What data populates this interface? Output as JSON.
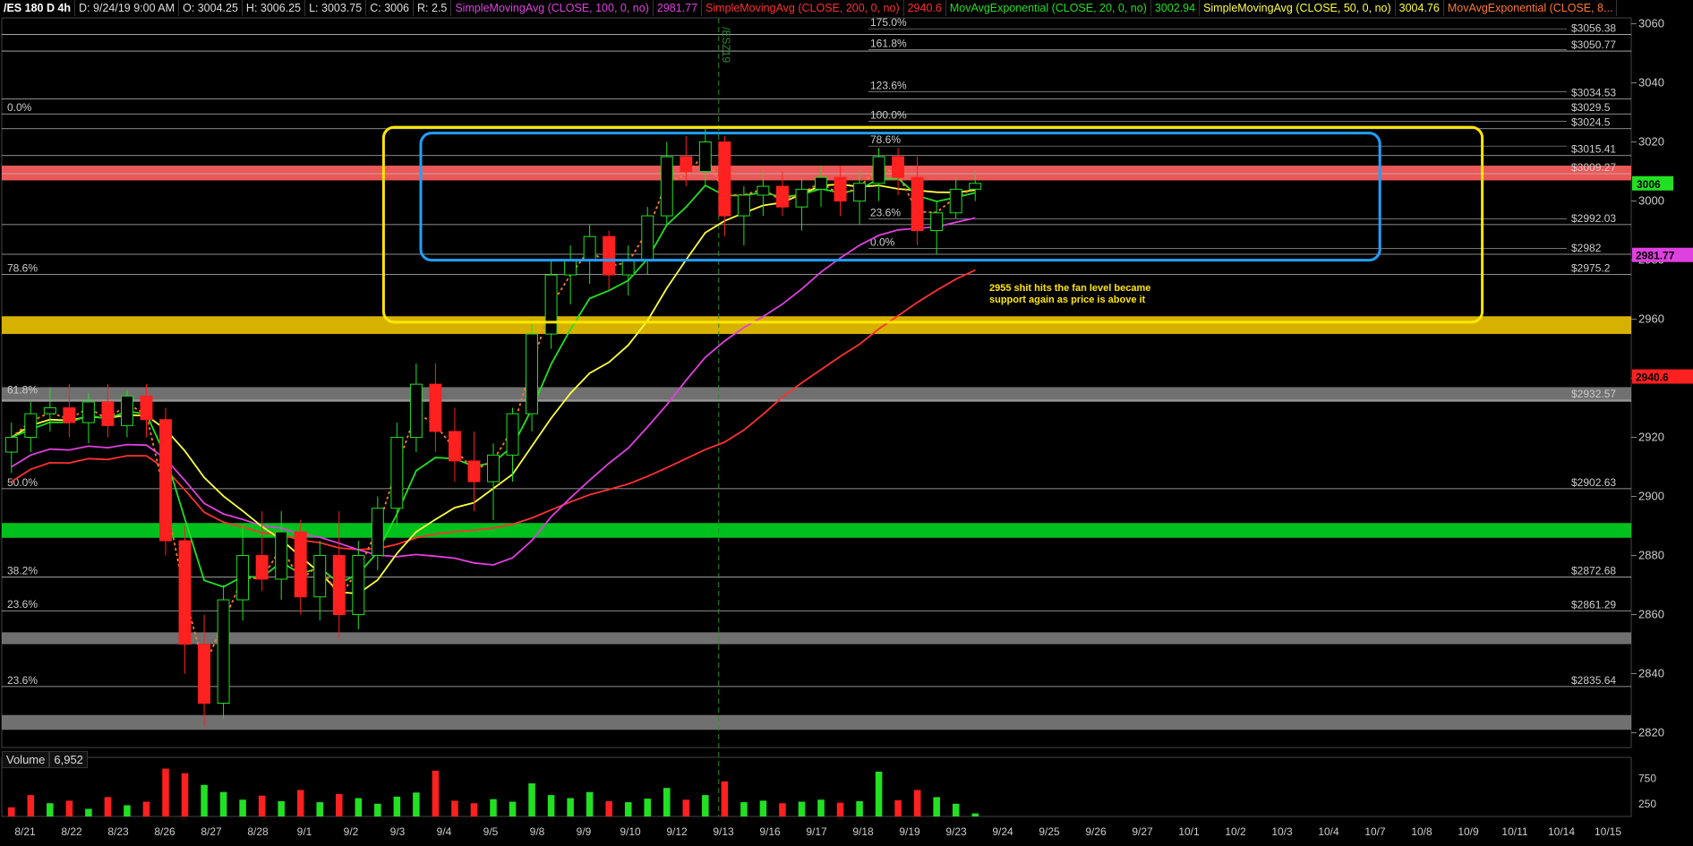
{
  "header": {
    "symbol": "/ES 180 D 4h",
    "date": "D: 9/24/19 9:00 AM",
    "open": "O: 3004.25",
    "high": "H: 3006.25",
    "low": "L: 3003.75",
    "close": "C: 3006",
    "range": "R: 2.5",
    "studies": [
      {
        "label": "SimpleMovingAvg (CLOSE, 100, 0, no)",
        "value": "2981.77",
        "color": "#e040e0"
      },
      {
        "label": "SimpleMovingAvg (CLOSE, 200, 0, no)",
        "value": "2940.6",
        "color": "#ff3030"
      },
      {
        "label": "MovAvgExponential (CLOSE, 20, 0, no)",
        "value": "3002.94",
        "color": "#22e022"
      },
      {
        "label": "SimpleMovingAvg (CLOSE, 50, 0, no)",
        "value": "3004.76",
        "color": "#ffff30"
      },
      {
        "label": "MovAvgExponential (CLOSE, 8...",
        "value": "",
        "color": "#ff7a30"
      }
    ]
  },
  "colors": {
    "up": "#22e022",
    "down": "#ff2020",
    "sma100": "#e040e0",
    "sma200": "#ff3030",
    "ema20": "#22e022",
    "sma50": "#ffff40",
    "ema8": "#ff7a30",
    "red_zone": "#ff6060",
    "yellow_zone": "#e8c000",
    "green_zone": "#00d020",
    "grey_zone": "#7a7a7a",
    "blue_box": "#20a0ff",
    "yellow_box": "#ffe600"
  },
  "chart_data": {
    "type": "candlestick",
    "ylim": [
      2815,
      3062
    ],
    "y_ticks": [
      2820,
      2840,
      2860,
      2880,
      2900,
      2920,
      2940,
      2960,
      2980,
      3000,
      3020,
      3040,
      3060
    ],
    "x_ticks": [
      "8/21",
      "8/22",
      "8/23",
      "8/26",
      "8/27",
      "8/28",
      "9/1",
      "9/2",
      "9/3",
      "9/4",
      "9/5",
      "9/8",
      "9/9",
      "9/10",
      "9/12",
      "9/13",
      "9/16",
      "9/17",
      "9/18",
      "9/19",
      "9/23",
      "9/24",
      "9/25",
      "9/26",
      "9/27",
      "10/1",
      "10/2",
      "10/3",
      "10/4",
      "10/7",
      "10/8",
      "10/9",
      "10/11",
      "10/14",
      "10/15"
    ],
    "last_price": "3006",
    "last_price_value": 3006,
    "badges": [
      {
        "text": "2981.77",
        "value": 2981.77,
        "color": "#e040e0"
      },
      {
        "text": "2940.6",
        "value": 2940.6,
        "color": "#ff2020"
      }
    ],
    "price_levels": [
      {
        "label": "$3056.38",
        "value": 3056.38
      },
      {
        "label": "$3050.77",
        "value": 3050.77
      },
      {
        "label": "$3034.53",
        "value": 3034.53
      },
      {
        "label": "$3029.5",
        "value": 3029.5
      },
      {
        "label": "$3024.5",
        "value": 3024.5
      },
      {
        "label": "$3015.41",
        "value": 3015.41
      },
      {
        "label": "$3009.27",
        "value": 3009.27
      },
      {
        "label": "$2992.03",
        "value": 2992.03
      },
      {
        "label": "$2982",
        "value": 2982
      },
      {
        "label": "$2975.2",
        "value": 2975.2
      },
      {
        "label": "$2932.57",
        "value": 2932.57
      },
      {
        "label": "$2902.63",
        "value": 2902.63
      },
      {
        "label": "$2872.68",
        "value": 2872.68
      },
      {
        "label": "$2861.29",
        "value": 2861.29
      },
      {
        "label": "$2835.64",
        "value": 2835.64
      }
    ],
    "fib_right": [
      {
        "label": "175.0%",
        "value": 3058.3
      },
      {
        "label": "161.8%",
        "value": 3051.2
      },
      {
        "label": "123.6%",
        "value": 3037.0
      },
      {
        "label": "100.0%",
        "value": 3027.0
      },
      {
        "label": "78.6%",
        "value": 3018.6
      },
      {
        "label": "23.6%",
        "value": 2994.0
      },
      {
        "label": "0.0%",
        "value": 2984.0
      }
    ],
    "fib_left": [
      {
        "label": "0.0%",
        "value": 3029.5
      },
      {
        "label": "78.6%",
        "value": 2975.2
      },
      {
        "label": "61.8%",
        "value": 2934.0
      },
      {
        "label": "50.0%",
        "value": 2902.6
      },
      {
        "label": "38.2%",
        "value": 2872.7
      },
      {
        "label": "23.6%",
        "value": 2861.3
      },
      {
        "label": "23.6%",
        "value": 2835.6
      }
    ],
    "zones": [
      {
        "color": "red",
        "from": 3007,
        "to": 3012
      },
      {
        "color": "yellow",
        "from": 2955,
        "to": 2961
      },
      {
        "color": "grey",
        "from": 2932,
        "to": 2937
      },
      {
        "color": "green",
        "from": 2886,
        "to": 2891
      },
      {
        "color": "grey",
        "from": 2850,
        "to": 2854
      },
      {
        "color": "grey",
        "from": 2821,
        "to": 2826
      }
    ],
    "boxes": [
      {
        "color": "yellow",
        "x_from": 8.2,
        "x_to": 31.8,
        "y_from": 2959,
        "y_to": 3025
      },
      {
        "color": "blue",
        "x_from": 9.0,
        "x_to": 29.6,
        "y_from": 2980,
        "y_to": 3023
      }
    ],
    "annotation": "2955 shit hits the fan level became support again as price is above it",
    "expiry_label": "/ESZ19",
    "expiry_x": 15.4,
    "candles": [
      [
        2915,
        2925,
        2908,
        2920
      ],
      [
        2920,
        2932,
        2915,
        2928
      ],
      [
        2928,
        2937,
        2922,
        2930
      ],
      [
        2930,
        2938,
        2920,
        2925
      ],
      [
        2925,
        2935,
        2918,
        2932
      ],
      [
        2932,
        2938,
        2920,
        2924
      ],
      [
        2924,
        2936,
        2920,
        2934
      ],
      [
        2934,
        2938,
        2920,
        2926
      ],
      [
        2926,
        2930,
        2880,
        2885
      ],
      [
        2885,
        2890,
        2840,
        2850
      ],
      [
        2850,
        2860,
        2822,
        2830
      ],
      [
        2830,
        2870,
        2825,
        2865
      ],
      [
        2865,
        2890,
        2858,
        2880
      ],
      [
        2880,
        2895,
        2868,
        2872
      ],
      [
        2872,
        2895,
        2865,
        2888
      ],
      [
        2888,
        2892,
        2860,
        2866
      ],
      [
        2866,
        2885,
        2858,
        2880
      ],
      [
        2880,
        2895,
        2852,
        2860
      ],
      [
        2860,
        2885,
        2855,
        2880
      ],
      [
        2880,
        2900,
        2875,
        2896
      ],
      [
        2896,
        2925,
        2890,
        2920
      ],
      [
        2920,
        2945,
        2915,
        2938
      ],
      [
        2938,
        2945,
        2915,
        2922
      ],
      [
        2922,
        2930,
        2905,
        2912
      ],
      [
        2912,
        2922,
        2895,
        2905
      ],
      [
        2905,
        2918,
        2892,
        2914
      ],
      [
        2914,
        2930,
        2905,
        2928
      ],
      [
        2928,
        2960,
        2922,
        2955
      ],
      [
        2955,
        2980,
        2950,
        2975
      ],
      [
        2975,
        2985,
        2965,
        2980
      ],
      [
        2980,
        2992,
        2972,
        2988
      ],
      [
        2988,
        2990,
        2970,
        2975
      ],
      [
        2975,
        2985,
        2968,
        2980
      ],
      [
        2980,
        2998,
        2975,
        2995
      ],
      [
        2995,
        3020,
        2992,
        3015
      ],
      [
        3015,
        3022,
        3005,
        3010
      ],
      [
        3010,
        3025,
        3005,
        3020
      ],
      [
        3020,
        3022,
        2988,
        2995
      ],
      [
        2995,
        3005,
        2985,
        3002
      ],
      [
        3002,
        3010,
        2995,
        3005
      ],
      [
        3005,
        3010,
        2995,
        2998
      ],
      [
        2998,
        3008,
        2990,
        3004
      ],
      [
        3004,
        3012,
        2998,
        3008
      ],
      [
        3008,
        3012,
        2995,
        3000
      ],
      [
        3000,
        3010,
        2992,
        3006
      ],
      [
        3006,
        3018,
        3000,
        3015
      ],
      [
        3015,
        3018,
        3002,
        3008
      ],
      [
        3008,
        3015,
        2985,
        2990
      ],
      [
        2990,
        3000,
        2982,
        2996
      ],
      [
        2996,
        3008,
        2994,
        3004
      ],
      [
        3004,
        3010,
        3000,
        3006
      ]
    ],
    "volume": {
      "label": "Volume",
      "value": "6,952",
      "ticks": [
        "750",
        "250"
      ],
      "ylim": [
        0,
        950
      ],
      "bars": [
        [
          180,
          "down"
        ],
        [
          420,
          "down"
        ],
        [
          260,
          "up"
        ],
        [
          310,
          "down"
        ],
        [
          150,
          "up"
        ],
        [
          380,
          "down"
        ],
        [
          220,
          "up"
        ],
        [
          290,
          "down"
        ],
        [
          940,
          "down"
        ],
        [
          850,
          "down"
        ],
        [
          620,
          "up"
        ],
        [
          480,
          "up"
        ],
        [
          330,
          "up"
        ],
        [
          410,
          "down"
        ],
        [
          300,
          "up"
        ],
        [
          520,
          "down"
        ],
        [
          280,
          "up"
        ],
        [
          440,
          "down"
        ],
        [
          360,
          "up"
        ],
        [
          250,
          "up"
        ],
        [
          390,
          "up"
        ],
        [
          470,
          "up"
        ],
        [
          900,
          "down"
        ],
        [
          310,
          "down"
        ],
        [
          260,
          "down"
        ],
        [
          340,
          "up"
        ],
        [
          290,
          "up"
        ],
        [
          650,
          "up"
        ],
        [
          420,
          "up"
        ],
        [
          360,
          "up"
        ],
        [
          480,
          "up"
        ],
        [
          300,
          "down"
        ],
        [
          280,
          "up"
        ],
        [
          350,
          "up"
        ],
        [
          560,
          "up"
        ],
        [
          330,
          "down"
        ],
        [
          420,
          "up"
        ],
        [
          690,
          "down"
        ],
        [
          280,
          "up"
        ],
        [
          310,
          "up"
        ],
        [
          260,
          "down"
        ],
        [
          290,
          "up"
        ],
        [
          330,
          "up"
        ],
        [
          270,
          "down"
        ],
        [
          300,
          "up"
        ],
        [
          880,
          "up"
        ],
        [
          320,
          "down"
        ],
        [
          520,
          "down"
        ],
        [
          380,
          "up"
        ],
        [
          250,
          "up"
        ],
        [
          60,
          "up"
        ]
      ]
    }
  }
}
